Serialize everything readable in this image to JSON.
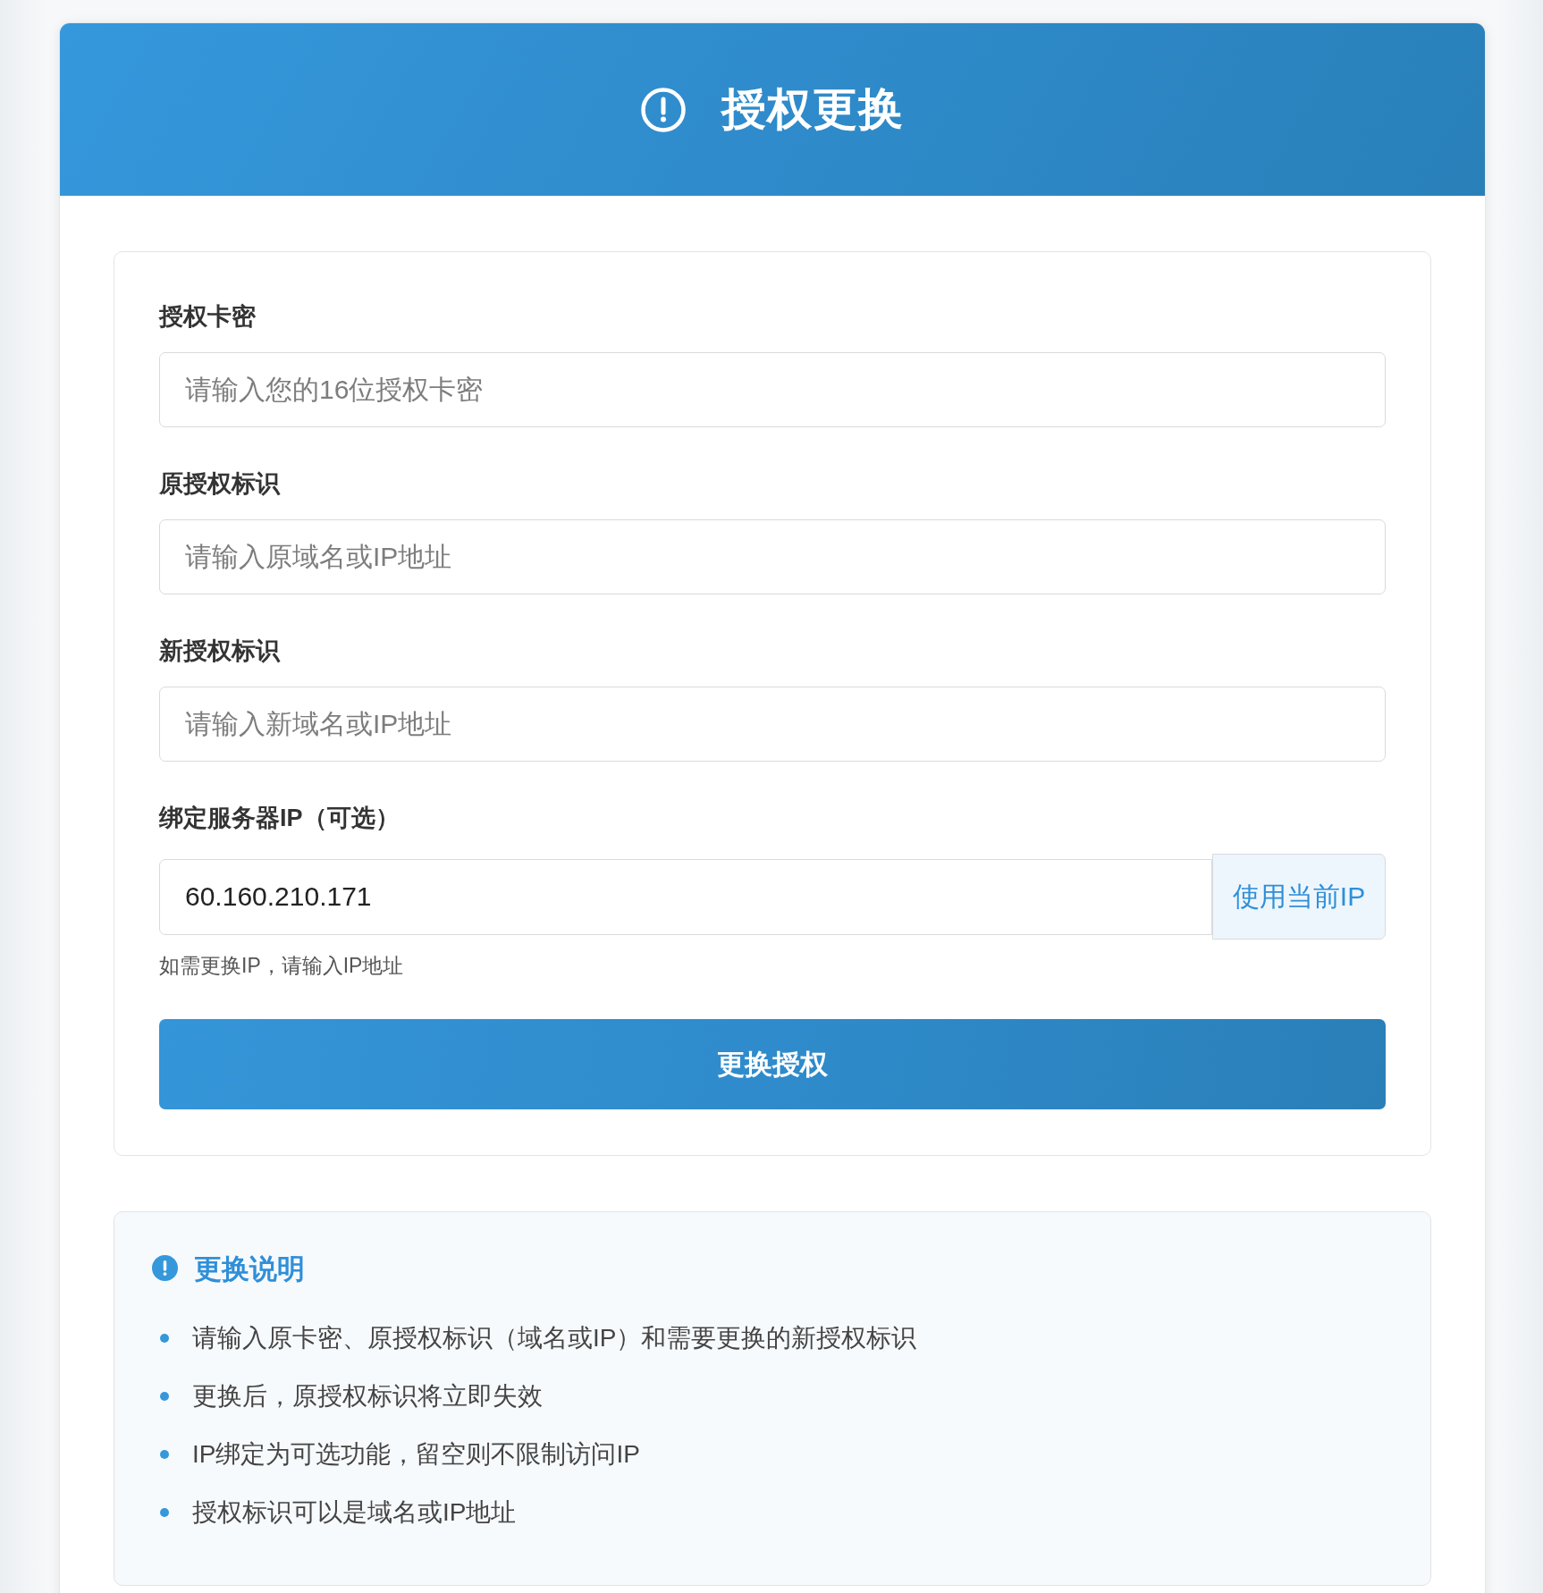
{
  "header": {
    "title": "授权更换"
  },
  "form": {
    "fields": [
      {
        "kind": "input",
        "label": "授权卡密",
        "placeholder": "请输入您的16位授权卡密"
      },
      {
        "kind": "input",
        "label": "原授权标识",
        "placeholder": "请输入原域名或IP地址"
      },
      {
        "kind": "input",
        "label": "新授权标识",
        "placeholder": "请输入新域名或IP地址"
      },
      {
        "kind": "input-with-button",
        "label": "绑定服务器IP（可选）",
        "value": "60.160.210.171",
        "button": "使用当前IP",
        "hint": "如需更换IP，请输入IP地址"
      }
    ],
    "submit": "更换授权"
  },
  "notes": {
    "title": "更换说明",
    "items": [
      "请输入原卡密、原授权标识（域名或IP）和需要更换的新授权标识",
      "更换后，原授权标识将立即失效",
      "IP绑定为可选功能，留空则不限制访问IP",
      "授权标识可以是域名或IP地址"
    ]
  }
}
